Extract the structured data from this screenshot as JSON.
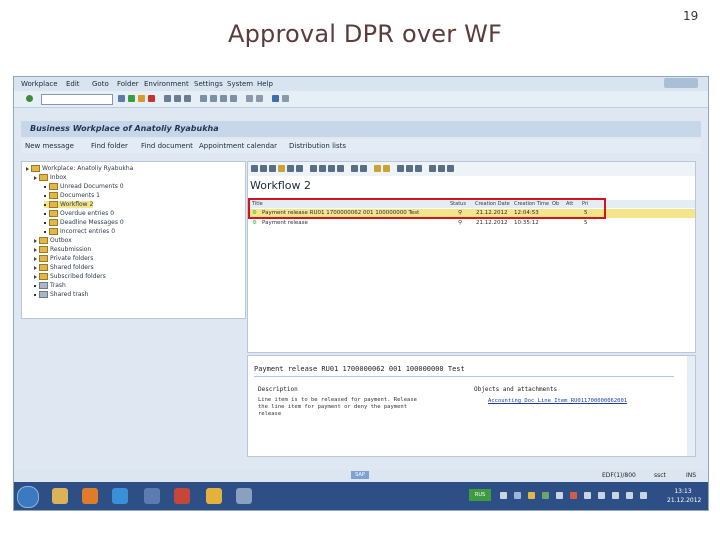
{
  "slide": {
    "title": "Approval DPR over WF",
    "page_number": "19"
  },
  "sap": {
    "menu": [
      "Workplace",
      "Edit",
      "Goto",
      "Folder",
      "Environment",
      "Settings",
      "System",
      "Help"
    ],
    "window_title": "Business Workplace of Anatoliy Ryabukha",
    "app_toolbar": [
      "New message",
      "Find folder",
      "Find document",
      "Appointment calendar",
      "Distribution lists"
    ],
    "tree": [
      {
        "label": "Workplace: Anatoliy Ryabukha"
      },
      {
        "label": "Inbox"
      },
      {
        "label": "Unread Documents 0"
      },
      {
        "label": "Documents 1"
      },
      {
        "label": "Workflow 2"
      },
      {
        "label": "Overdue entries 0"
      },
      {
        "label": "Deadline Messages 0"
      },
      {
        "label": "Incorrect entries 0"
      },
      {
        "label": "Outbox"
      },
      {
        "label": "Resubmission"
      },
      {
        "label": "Private folders"
      },
      {
        "label": "Shared folders"
      },
      {
        "label": "Subscribed folders"
      },
      {
        "label": "Trash"
      },
      {
        "label": "Shared trash"
      }
    ],
    "workflow": {
      "title": "Workflow 2",
      "columns": [
        "Title",
        "Status",
        "Creation Date",
        "Creation Time",
        "Ob",
        "Att",
        "Pri"
      ],
      "rows": [
        {
          "title": "Payment release RU01 1700000062 001 100000000 Test",
          "date": "21.12.2012",
          "time": "12:04:53",
          "pri": "5"
        },
        {
          "title": "Payment release",
          "date": "21.12.2012",
          "time": "10:35:12",
          "pri": "5"
        }
      ]
    },
    "preview": {
      "title": "Payment release RU01 1700000062 001 100000000 Test",
      "description_header": "Description",
      "objects_header": "Objects and attachments",
      "description_lines": [
        "Line item is to be released for payment. Release",
        "the line item for payment or deny the payment",
        "release"
      ],
      "attachment_link": "Accounting Doc Line Item RU011700000062001"
    },
    "statusbar": {
      "sap_logo": "SAP",
      "system": "EDF(1)/800",
      "server": "ssct",
      "mode": "INS"
    }
  },
  "taskbar": {
    "lang": "RUS",
    "time": "13:13",
    "date": "21.12.2012"
  }
}
